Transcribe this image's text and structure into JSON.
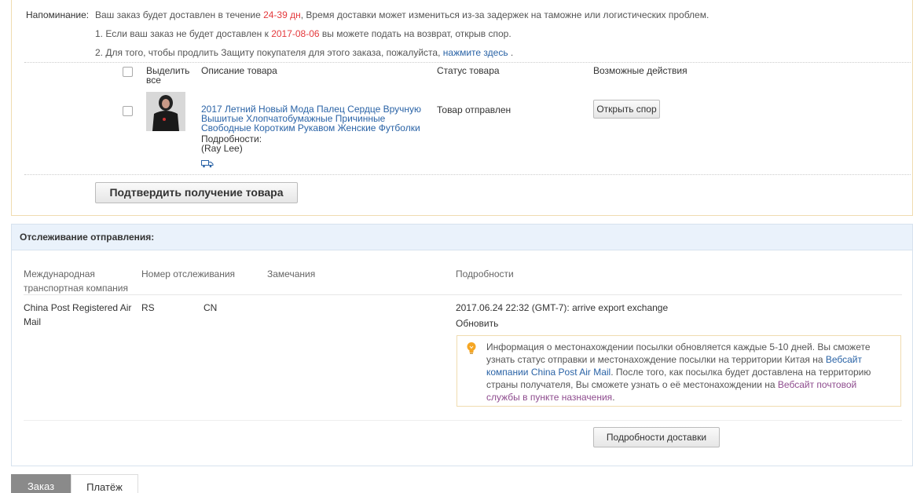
{
  "order": {
    "reminder_label": "Напоминание:",
    "line1_pre": "Ваш заказ будет доставлен в течение ",
    "line1_days": "24-39 дн",
    "line1_post": ", Время доставки может измениться из-за задержек на таможне или логистических проблем.",
    "line2_pre": "1. Если ваш заказ не будет доставлен к ",
    "line2_date": "2017-08-06",
    "line2_post": " вы можете подать на возврат, открыв спор.",
    "line3_pre": "2. Для того, чтобы продлить Защиту покупателя для этого заказа, пожалуйста, ",
    "line3_link": "нажмите здесь",
    "line3_post": " .",
    "columns": {
      "select_all": "Выделить все",
      "description": "Описание товара",
      "status": "Статус товара",
      "actions": "Возможные действия"
    },
    "item": {
      "title": "2017 Летний Новый Мода Палец Сердце Вручную Вышитые Хлопчатобумажные Причинные Свободные Коротким Рукавом Женские Футболки",
      "details_label": "Подробности:",
      "details_value": "(Ray Lee)",
      "status": "Товар отправлен",
      "dispute_button": "Открыть спор"
    },
    "confirm_button": "Подтвердить получение товара"
  },
  "tracking": {
    "title": "Отслеживание отправления:",
    "headers": {
      "company": "Международная транспортная компания",
      "number": "Номер отслеживания",
      "remarks": "Замечания",
      "details": "Подробности"
    },
    "row": {
      "company": "China Post Registered Air Mail",
      "number_prefix": "RS",
      "number_suffix": "CN",
      "remarks": "",
      "event": "2017.06.24 22:32 (GMT-7): arrive export exchange",
      "refresh": "Обновить"
    },
    "info": {
      "part1": "Информация о местонахождении посылки обновляется каждые 5-10 дней. Вы сможете узнать статус отправки и местонахождение посылки на территории Китая на ",
      "link1": "Вебсайт компании China Post Air Mail",
      "part2": ". После того, как посылка будет доставлена на территорию страны получателя, Вы сможете узнать о её местонахождении на ",
      "link2": "Вебсайт почтовой службы в пункте назначения",
      "part3": "."
    },
    "delivery_button": "Подробности доставки"
  },
  "tabs": {
    "order": "Заказ",
    "payment": "Платёж"
  },
  "colors": {
    "accent_red": "#e4393c",
    "link_blue": "#2a63a6",
    "header_bg": "#eaf2fb"
  }
}
